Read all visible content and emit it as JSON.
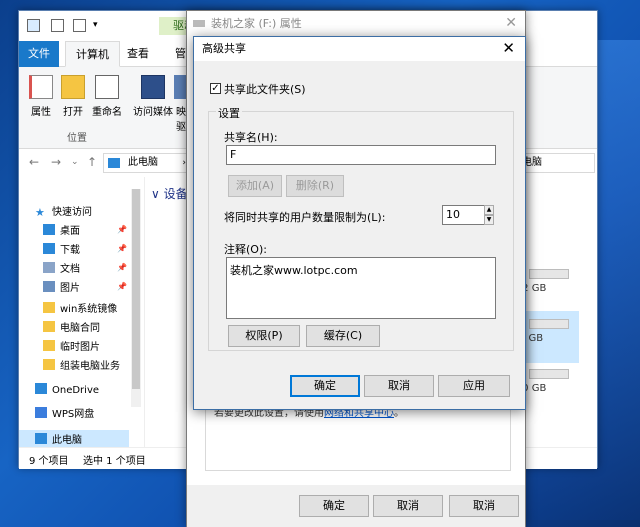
{
  "explorer": {
    "ribbon_tabs": [
      "文件",
      "计算机",
      "查看",
      "管"
    ],
    "drive_tools_tab": "驱动",
    "ribbon_buttons": [
      "属性",
      "打开",
      "重命名",
      "访问媒体",
      "映",
      "驱"
    ],
    "ribbon_group_label": "位置",
    "address": "此电脑",
    "address_right": "中电脑",
    "content_header": "设备",
    "nav_items": [
      {
        "label": "快速访问",
        "icon": "star-icon",
        "pinned": false
      },
      {
        "label": "桌面",
        "icon": "desktop-icon",
        "pinned": true
      },
      {
        "label": "下载",
        "icon": "download-icon",
        "pinned": true
      },
      {
        "label": "文档",
        "icon": "document-icon",
        "pinned": true
      },
      {
        "label": "图片",
        "icon": "picture-icon",
        "pinned": true
      },
      {
        "label": "win系统镜像",
        "icon": "folder-icon",
        "pinned": false
      },
      {
        "label": "电脑合同",
        "icon": "folder-icon",
        "pinned": false
      },
      {
        "label": "临时图片",
        "icon": "folder-icon",
        "pinned": false
      },
      {
        "label": "组装电脑业务",
        "icon": "folder-icon",
        "pinned": false
      },
      {
        "label": "OneDrive",
        "icon": "cloud-icon",
        "pinned": false
      },
      {
        "label": "WPS网盘",
        "icon": "wps-cloud-icon",
        "pinned": false
      },
      {
        "label": "此电脑",
        "icon": "computer-icon",
        "pinned": false
      }
    ],
    "disk_sizes": [
      ".2 GB",
      "0 GB",
      ".0 GB"
    ],
    "status_count": "9 个项目",
    "status_selected": "选中 1 个项目"
  },
  "properties": {
    "title": "装机之家 (F:) 属性",
    "note_prefix": "若要更改此设置，请使用",
    "note_link": "网络和共享中心",
    "note_suffix": "。",
    "ok": "确定",
    "cancel": "取消",
    "apply": "取消"
  },
  "advanced_share": {
    "title": "高级共享",
    "share_checkbox_label": "共享此文件夹(S)",
    "share_checked": true,
    "settings_label": "设置",
    "share_name_label": "共享名(H):",
    "share_name_value": "F",
    "add_button": "添加(A)",
    "remove_button": "删除(R)",
    "limit_label": "将同时共享的用户数量限制为(L):",
    "limit_value": "10",
    "comment_label": "注释(O):",
    "comment_value": "装机之家www.lotpc.com",
    "permissions_button": "权限(P)",
    "caching_button": "缓存(C)",
    "ok": "确定",
    "cancel": "取消",
    "apply": "应用"
  },
  "colors": {
    "accent": "#0078d7",
    "file_tab": "#1979ca",
    "link": "#0055cc"
  }
}
